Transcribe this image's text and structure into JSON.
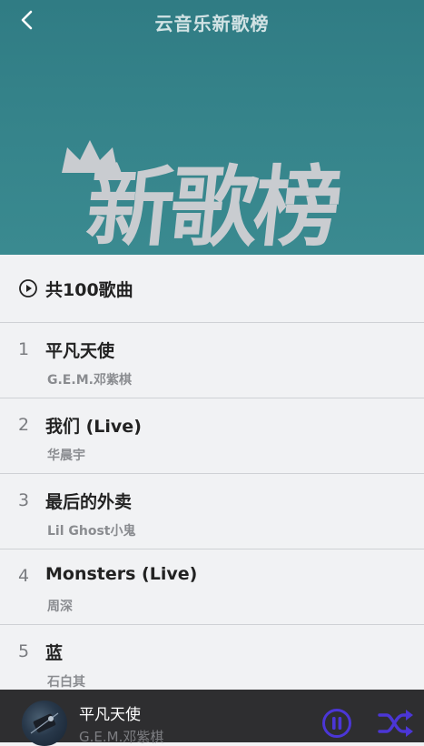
{
  "header": {
    "title": "云音乐新歌榜",
    "cover_text": "新歌榜"
  },
  "list": {
    "count_label": "共100歌曲",
    "songs": [
      {
        "rank": "1",
        "title": "平凡天使",
        "artist": "G.E.M.邓紫棋"
      },
      {
        "rank": "2",
        "title": "我们 (Live)",
        "artist": "华晨宇"
      },
      {
        "rank": "3",
        "title": "最后的外卖",
        "artist": "Lil Ghost小鬼"
      },
      {
        "rank": "4",
        "title": "Monsters (Live)",
        "artist": "周深"
      },
      {
        "rank": "5",
        "title": "蓝",
        "artist": "石白其"
      }
    ]
  },
  "player": {
    "title": "平凡天使",
    "artist": "G.E.M.邓紫棋",
    "accent_color": "#4b36d6"
  }
}
